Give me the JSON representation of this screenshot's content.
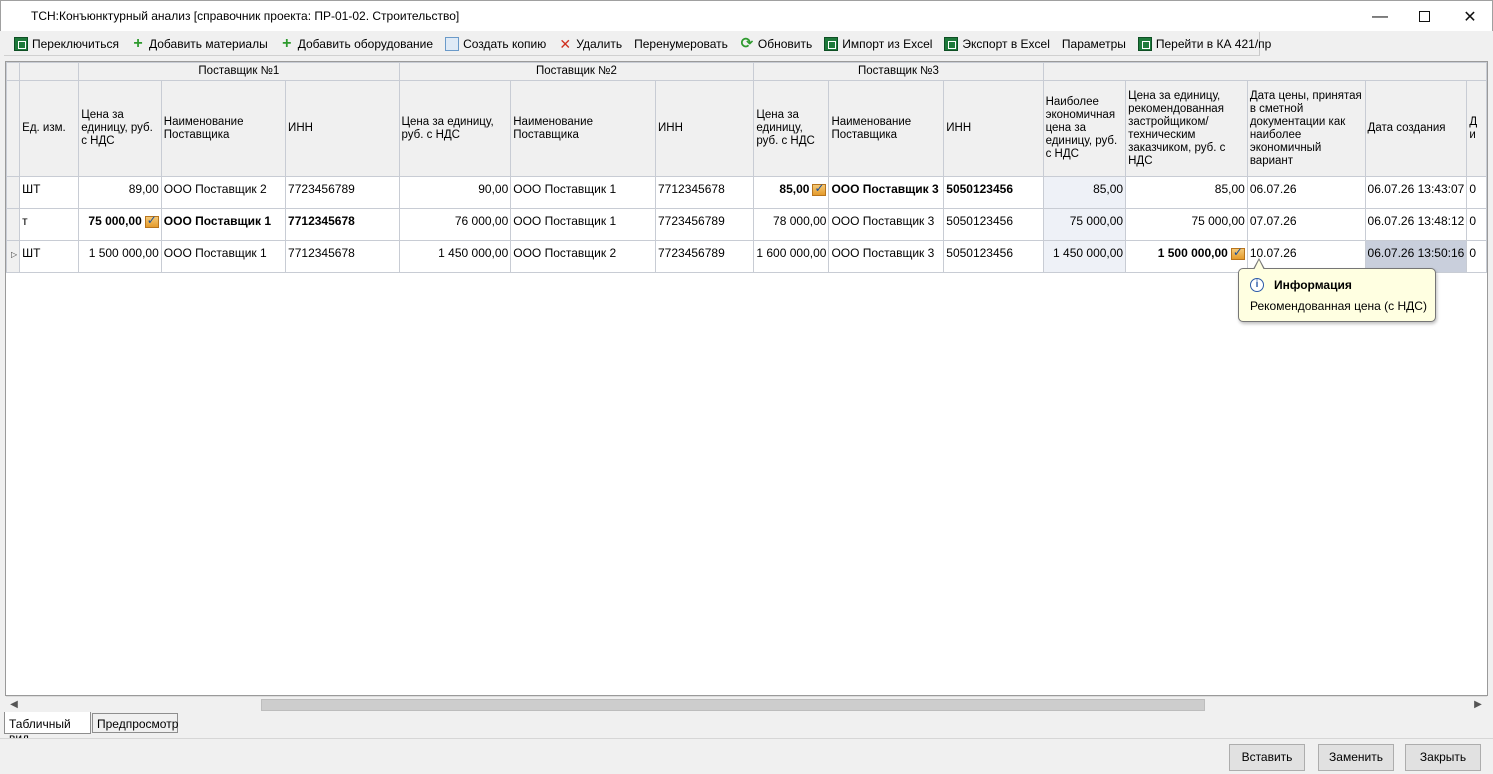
{
  "window": {
    "title": "ТСН:Конъюнктурный анализ [справочник проекта: ПР-01-02. Строительство]",
    "minimize": "—",
    "close": "✕"
  },
  "toolbar": {
    "items": [
      {
        "label": "Переключиться",
        "icon": "excel-ka-icon"
      },
      {
        "label": "Добавить материалы",
        "icon": "plus-icon"
      },
      {
        "label": "Добавить оборудование",
        "icon": "plus-icon"
      },
      {
        "label": "Создать копию",
        "icon": "copy-icon"
      },
      {
        "label": "Удалить",
        "icon": "delete-x-icon"
      },
      {
        "label": "Перенумеровать",
        "icon": ""
      },
      {
        "label": "Обновить",
        "icon": "refresh-icon"
      },
      {
        "label": "Импорт из Excel",
        "icon": "excel-icon"
      },
      {
        "label": "Экспорт в Excel",
        "icon": "excel-icon"
      },
      {
        "label": "Параметры",
        "icon": ""
      },
      {
        "label": "Перейти в КА 421/пр",
        "icon": "excel-ka-icon"
      }
    ]
  },
  "grid": {
    "groups": {
      "supplier1": "Поставщик №1",
      "supplier2": "Поставщик №2",
      "supplier3": "Поставщик №3"
    },
    "columns": {
      "unit": "Ед. изм.",
      "price": "Цена за единицу, руб. с НДС",
      "name": "Наименование Поставщика",
      "inn": "ИНН",
      "econ": "Наиболее экономичная цена за единицу, руб. с НДС",
      "recommended": "Цена за единицу, рекомендованная застройщиком/ техническим заказчиком, руб. с НДС",
      "price_date": "Дата цены, принятая в сметной документации как наиболее экономичный вариант",
      "created": "Дата создания",
      "cut": "Д и"
    },
    "rows": [
      {
        "unit": "ШТ",
        "s1_price": "89,00",
        "s1_name": "ООО Поставщик 2",
        "s1_inn": "7723456789",
        "s2_price": "90,00",
        "s2_name": "ООО Поставщик 1",
        "s2_inn": "7712345678",
        "s3_price": "85,00",
        "s3_name": "ООО Поставщик 3",
        "s3_inn": "5050123456",
        "econ": "85,00",
        "recommended": "85,00",
        "price_date": "06.07.26",
        "created": "06.07.26 13:43:07",
        "cut": "0"
      },
      {
        "unit": "т",
        "s1_price": "75 000,00",
        "s1_name": "ООО Поставщик 1",
        "s1_inn": "7712345678",
        "s2_price": "76 000,00",
        "s2_name": "ООО Поставщик 1",
        "s2_inn": "7723456789",
        "s3_price": "78 000,00",
        "s3_name": "ООО Поставщик 3",
        "s3_inn": "5050123456",
        "econ": "75 000,00",
        "recommended": "75 000,00",
        "price_date": "07.07.26",
        "created": "06.07.26 13:48:12",
        "cut": "0"
      },
      {
        "unit": "ШТ",
        "s1_price": "1 500 000,00",
        "s1_name": "ООО Поставщик 1",
        "s1_inn": "7712345678",
        "s2_price": "1 450 000,00",
        "s2_name": "ООО Поставщик 2",
        "s2_inn": "7723456789",
        "s3_price": "1 600 000,00",
        "s3_name": "ООО Поставщик 3",
        "s3_inn": "5050123456",
        "econ": "1 450 000,00",
        "recommended": "1 500 000,00",
        "price_date": "10.07.26",
        "created": "06.07.26 13:50:16",
        "cut": "0"
      }
    ]
  },
  "tooltip": {
    "title": "Информация",
    "text": "Рекомендованная цена (с НДС)",
    "icon": "info-icon"
  },
  "tabs": {
    "table_view": "Табличный вид",
    "preview": "Предпросмотр"
  },
  "footer": {
    "insert": "Вставить",
    "replace": "Заменить",
    "close": "Закрыть"
  }
}
